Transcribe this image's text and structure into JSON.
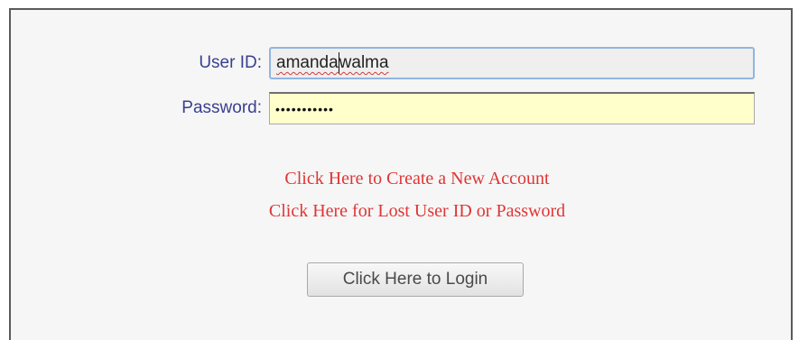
{
  "login_form": {
    "user_id": {
      "label": "User ID:",
      "value_before_caret": "amanda",
      "value_after_caret": "walma"
    },
    "password": {
      "label": "Password:",
      "masked_value": "•••••••••••"
    },
    "links": {
      "create_account": "Click Here to Create a New Account",
      "lost_credentials": "Click Here for Lost User ID or Password"
    },
    "login_button": "Click Here to Login"
  },
  "colors": {
    "label": "#3a3f8f",
    "link": "#e03535",
    "password_bg": "#ffffcc",
    "userid_focus_border": "#8fb6e3"
  }
}
